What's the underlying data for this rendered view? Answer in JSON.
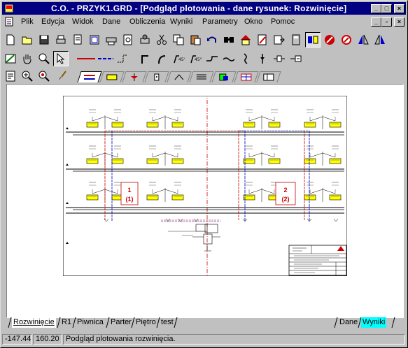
{
  "window": {
    "title": "C.O.  - PRZYK1.GRD - [Podgląd plotowania - dane rysunek: Rozwinięcie]",
    "controls": {
      "minimize": "_",
      "maximize": "□",
      "close": "×"
    }
  },
  "menubar": {
    "items": [
      "Plik",
      "Edycja",
      "Widok",
      "Dane",
      "Obliczenia",
      "Wyniki",
      "Parametry",
      "Okno",
      "Pomoc"
    ]
  },
  "toolbar1": {
    "icons": [
      "new-file-icon",
      "open-folder-icon",
      "save-icon",
      "print-icon",
      "print-preview-icon",
      "page-setup-icon",
      "plot-icon",
      "zoom-page-icon",
      "print-setup-icon",
      "cut-icon",
      "copy-icon",
      "paste-icon",
      "undo-icon",
      "find-icon",
      "building-icon",
      "edit-icon",
      "export-icon",
      "calculator-icon",
      "compare-icon",
      "stop-icon",
      "settings-icon",
      "flip-left-icon",
      "flip-right-icon"
    ]
  },
  "toolbar2": {
    "icons": [
      "draw-mode-icon",
      "pan-hand-icon",
      "zoom-icon",
      "select-arrow-icon",
      "pipe-supply-icon",
      "pipe-return-icon",
      "node-icon",
      "elbow-90-icon",
      "elbow-curve-icon",
      "elbow-45-left-icon",
      "elbow-45-right-icon",
      "pipe-bend-icon",
      "pipe-s-icon",
      "riser-icon",
      "valve-icon",
      "fitting-icon",
      "connector-icon"
    ]
  },
  "toolbar3": {
    "icons": [
      "properties-icon",
      "zoom-in-icon",
      "zoom-fit-icon",
      "brush-icon"
    ],
    "tabs": [
      "pipes-tab",
      "radiator-tab",
      "valve-tab",
      "element-tab",
      "element2-tab",
      "lines-tab",
      "symbol-tab",
      "grid-tab",
      "table-tab"
    ]
  },
  "drawing": {
    "label_1": "1",
    "label_1b": "(1)",
    "label_2": "2",
    "label_2b": "(2)"
  },
  "bottom_tabs": {
    "left": [
      "Rozwinięcie",
      "R1",
      "Piwnica",
      "Parter",
      "Piętro",
      "test"
    ],
    "right": [
      "Dane",
      "Wyniki"
    ]
  },
  "status": {
    "x": "-147.44",
    "y": "160.20",
    "message": "Podgląd plotowania rozwinięcia."
  },
  "colors": {
    "titlebar": "#000080",
    "supply": "#cc0000",
    "return": "#0000cc",
    "radiator": "#ffff00",
    "tab_active": "#00ffff"
  }
}
